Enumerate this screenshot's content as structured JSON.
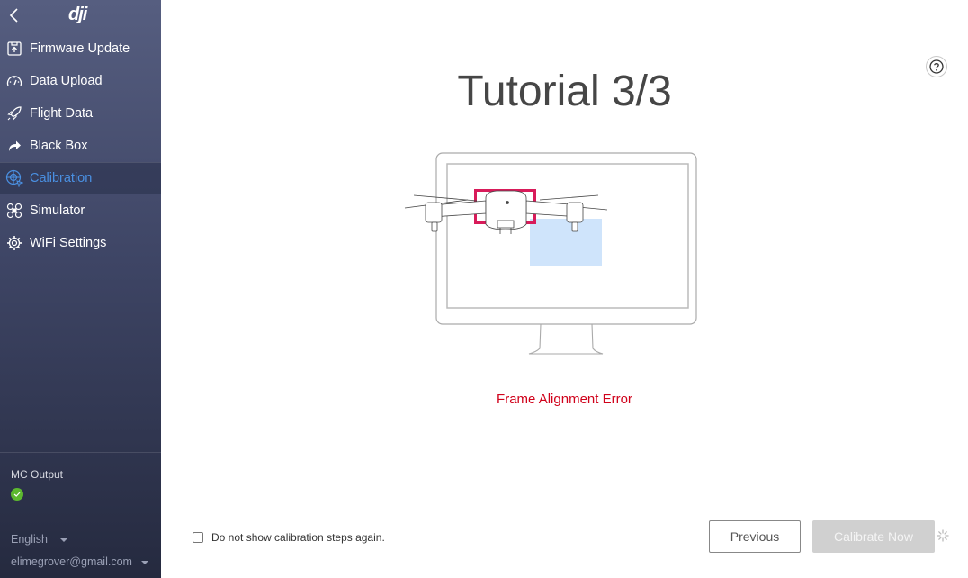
{
  "sidebar": {
    "logo": "dji",
    "items": [
      {
        "label": "Firmware Update",
        "icon": "firmware-update-icon"
      },
      {
        "label": "Data Upload",
        "icon": "gauge-icon"
      },
      {
        "label": "Flight Data",
        "icon": "rocket-icon"
      },
      {
        "label": "Black Box",
        "icon": "share-arrow-icon"
      },
      {
        "label": "Calibration",
        "icon": "calibration-target-icon",
        "active": true
      },
      {
        "label": "Simulator",
        "icon": "drone-icon"
      },
      {
        "label": "WiFi Settings",
        "icon": "gear-icon"
      }
    ],
    "mc_output": {
      "label": "MC Output",
      "status": "ok"
    },
    "language": "English",
    "account": "elimegrover@gmail.com"
  },
  "main": {
    "title": "Tutorial 3/3",
    "error_message": "Frame Alignment Error",
    "checkbox_label": "Do not show calibration steps again.",
    "checkbox_checked": false,
    "previous_label": "Previous",
    "calibrate_label": "Calibrate Now",
    "colors": {
      "accent": "#4a90e2",
      "error": "#d0021b",
      "frame_highlight": "#d81b5a",
      "target_area": "#cfe4fb",
      "ok": "#5cb82f"
    }
  }
}
